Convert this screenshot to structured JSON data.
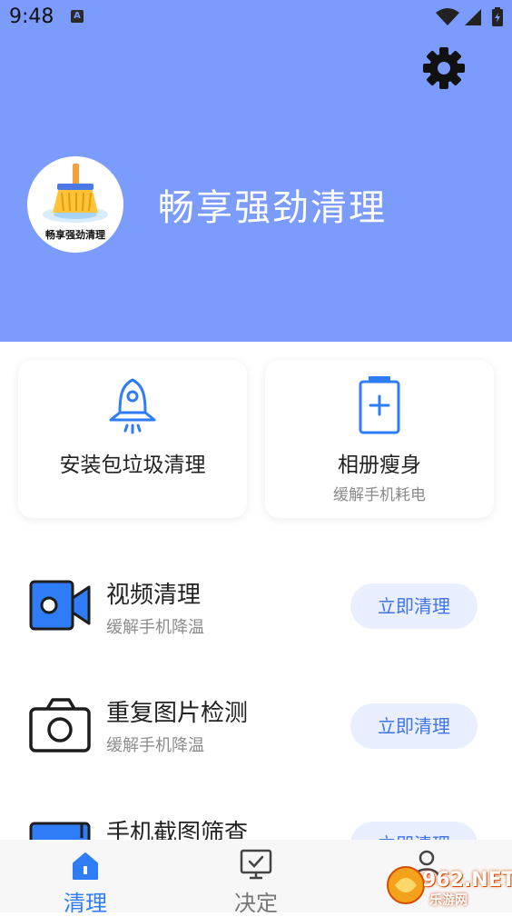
{
  "statusbar": {
    "time": "9:48",
    "a_badge": "A"
  },
  "header": {
    "app_title": "畅享强劲清理",
    "logo_text": "畅享强劲清理",
    "bg_color": "#7b9bfd"
  },
  "cards": [
    {
      "title": "安装包垃圾清理",
      "subtitle": "",
      "icon": "rocket-icon"
    },
    {
      "title": "相册瘦身",
      "subtitle": "缓解手机耗电",
      "icon": "battery-icon"
    }
  ],
  "rows": [
    {
      "title": "视频清理",
      "subtitle": "缓解手机降温",
      "button": "立即清理",
      "icon": "video-camera-icon"
    },
    {
      "title": "重复图片检测",
      "subtitle": "缓解手机降温",
      "button": "立即清理",
      "icon": "camera-icon"
    },
    {
      "title": "手机截图筛查",
      "subtitle": "",
      "button": "立即清理",
      "icon": "screenshot-icon"
    }
  ],
  "tabs": [
    {
      "label": "清理",
      "active": true,
      "icon": "home-icon"
    },
    {
      "label": "决定",
      "active": false,
      "icon": "monitor-check-icon"
    },
    {
      "label": "",
      "active": false,
      "icon": "profile-icon"
    }
  ],
  "watermark": {
    "text": "962.NET",
    "sub": "乐游网"
  },
  "colors": {
    "accent": "#3f73ec",
    "button_bg": "#e9efff",
    "icon_blue": "#2f7df6"
  }
}
